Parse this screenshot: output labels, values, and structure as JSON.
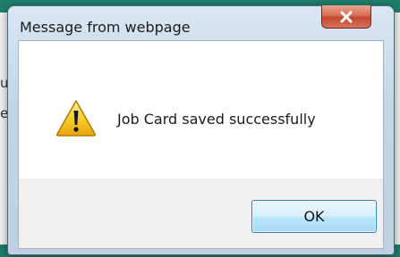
{
  "dialog": {
    "title": "Message from webpage",
    "message": "Job Card saved successfully",
    "ok_label": "OK",
    "icon": "warning-icon"
  },
  "background": {
    "fragment_1": "u",
    "fragment_2": "e"
  },
  "colors": {
    "close_button": "#d0563d",
    "ok_border": "#3c7fb1",
    "warning_yellow": "#f5c518"
  }
}
